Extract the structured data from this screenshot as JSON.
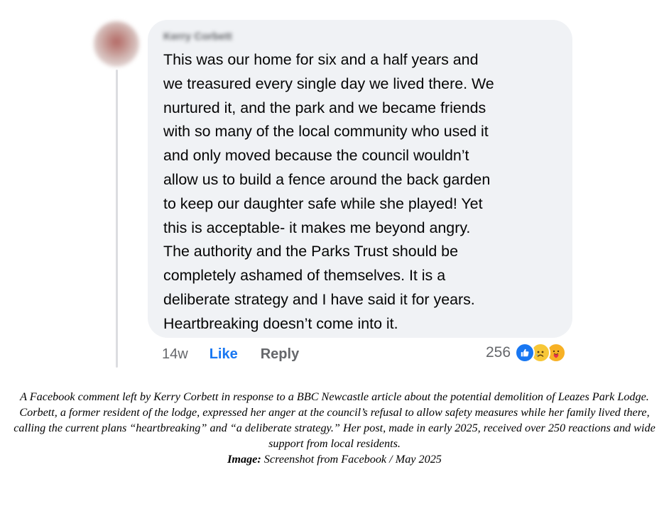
{
  "comment": {
    "author": "Kerry Corbett",
    "text": "This was our home for six and a half years and\nwe treasured every single day we lived there. We\nnurtured it, and the park and we became friends\nwith so many of the local community who used it\nand only moved because the council wouldn’t\nallow us to build a fence around the back garden\nto keep our daughter safe while she played! Yet\nthis is acceptable- it makes me beyond angry.\nThe authority and the Parks Trust should be\ncompletely ashamed of themselves. It is a\ndeliberate strategy and I have said it for years.\nHeartbreaking doesn’t come into it.",
    "timestamp": "14w",
    "like_label": "Like",
    "reply_label": "Reply",
    "reaction_count": "256",
    "reactions": [
      "like-icon",
      "sad-face-icon",
      "care-face-icon"
    ]
  },
  "caption": {
    "text": "A Facebook comment left by Kerry Corbett in response to a BBC Newcastle article about the potential demolition of Leazes Park Lodge. Corbett, a former resident of the lodge, expressed her anger at the council’s refusal to allow safety measures while her family lived there, calling the current plans “heartbreaking” and “a deliberate strategy.” Her post, made in early 2025, received over 250 reactions and wide support from local residents.",
    "credit_label": "Image:",
    "credit_text": "Screenshot from Facebook / May 2025"
  },
  "colors": {
    "bubble": "#f0f2f5",
    "like_blue": "#1877f2",
    "meta_gray": "#65676b",
    "text": "#050505"
  }
}
